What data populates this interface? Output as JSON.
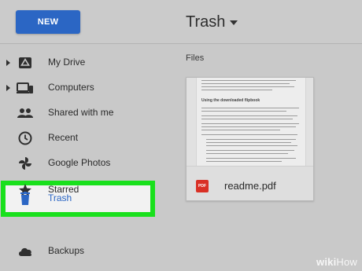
{
  "header": {
    "new_button_label": "NEW",
    "location_title": "Trash"
  },
  "sidebar": {
    "items": [
      {
        "label": "My Drive",
        "icon": "drive-icon",
        "expandable": true
      },
      {
        "label": "Computers",
        "icon": "computers-icon",
        "expandable": true
      },
      {
        "label": "Shared with me",
        "icon": "people-icon",
        "expandable": false
      },
      {
        "label": "Recent",
        "icon": "clock-icon",
        "expandable": false
      },
      {
        "label": "Google Photos",
        "icon": "pinwheel-icon",
        "expandable": false
      },
      {
        "label": "Starred",
        "icon": "star-icon",
        "expandable": false
      },
      {
        "label": "Trash",
        "icon": "trash-icon",
        "expandable": false,
        "selected": true
      },
      {
        "label": "Backups",
        "icon": "cloud-icon",
        "expandable": false
      }
    ]
  },
  "main": {
    "section_label": "Files",
    "files": [
      {
        "name": "readme.pdf",
        "type_badge": "PDF",
        "preview_heading": "Using the downloaded flipbook"
      }
    ]
  },
  "watermark": {
    "bold": "wiki",
    "light": "How"
  },
  "colors": {
    "accent_blue": "#2b66c4",
    "highlight_green": "#19e01c",
    "background": "#c9c9c9",
    "pdf_red": "#d93025"
  }
}
